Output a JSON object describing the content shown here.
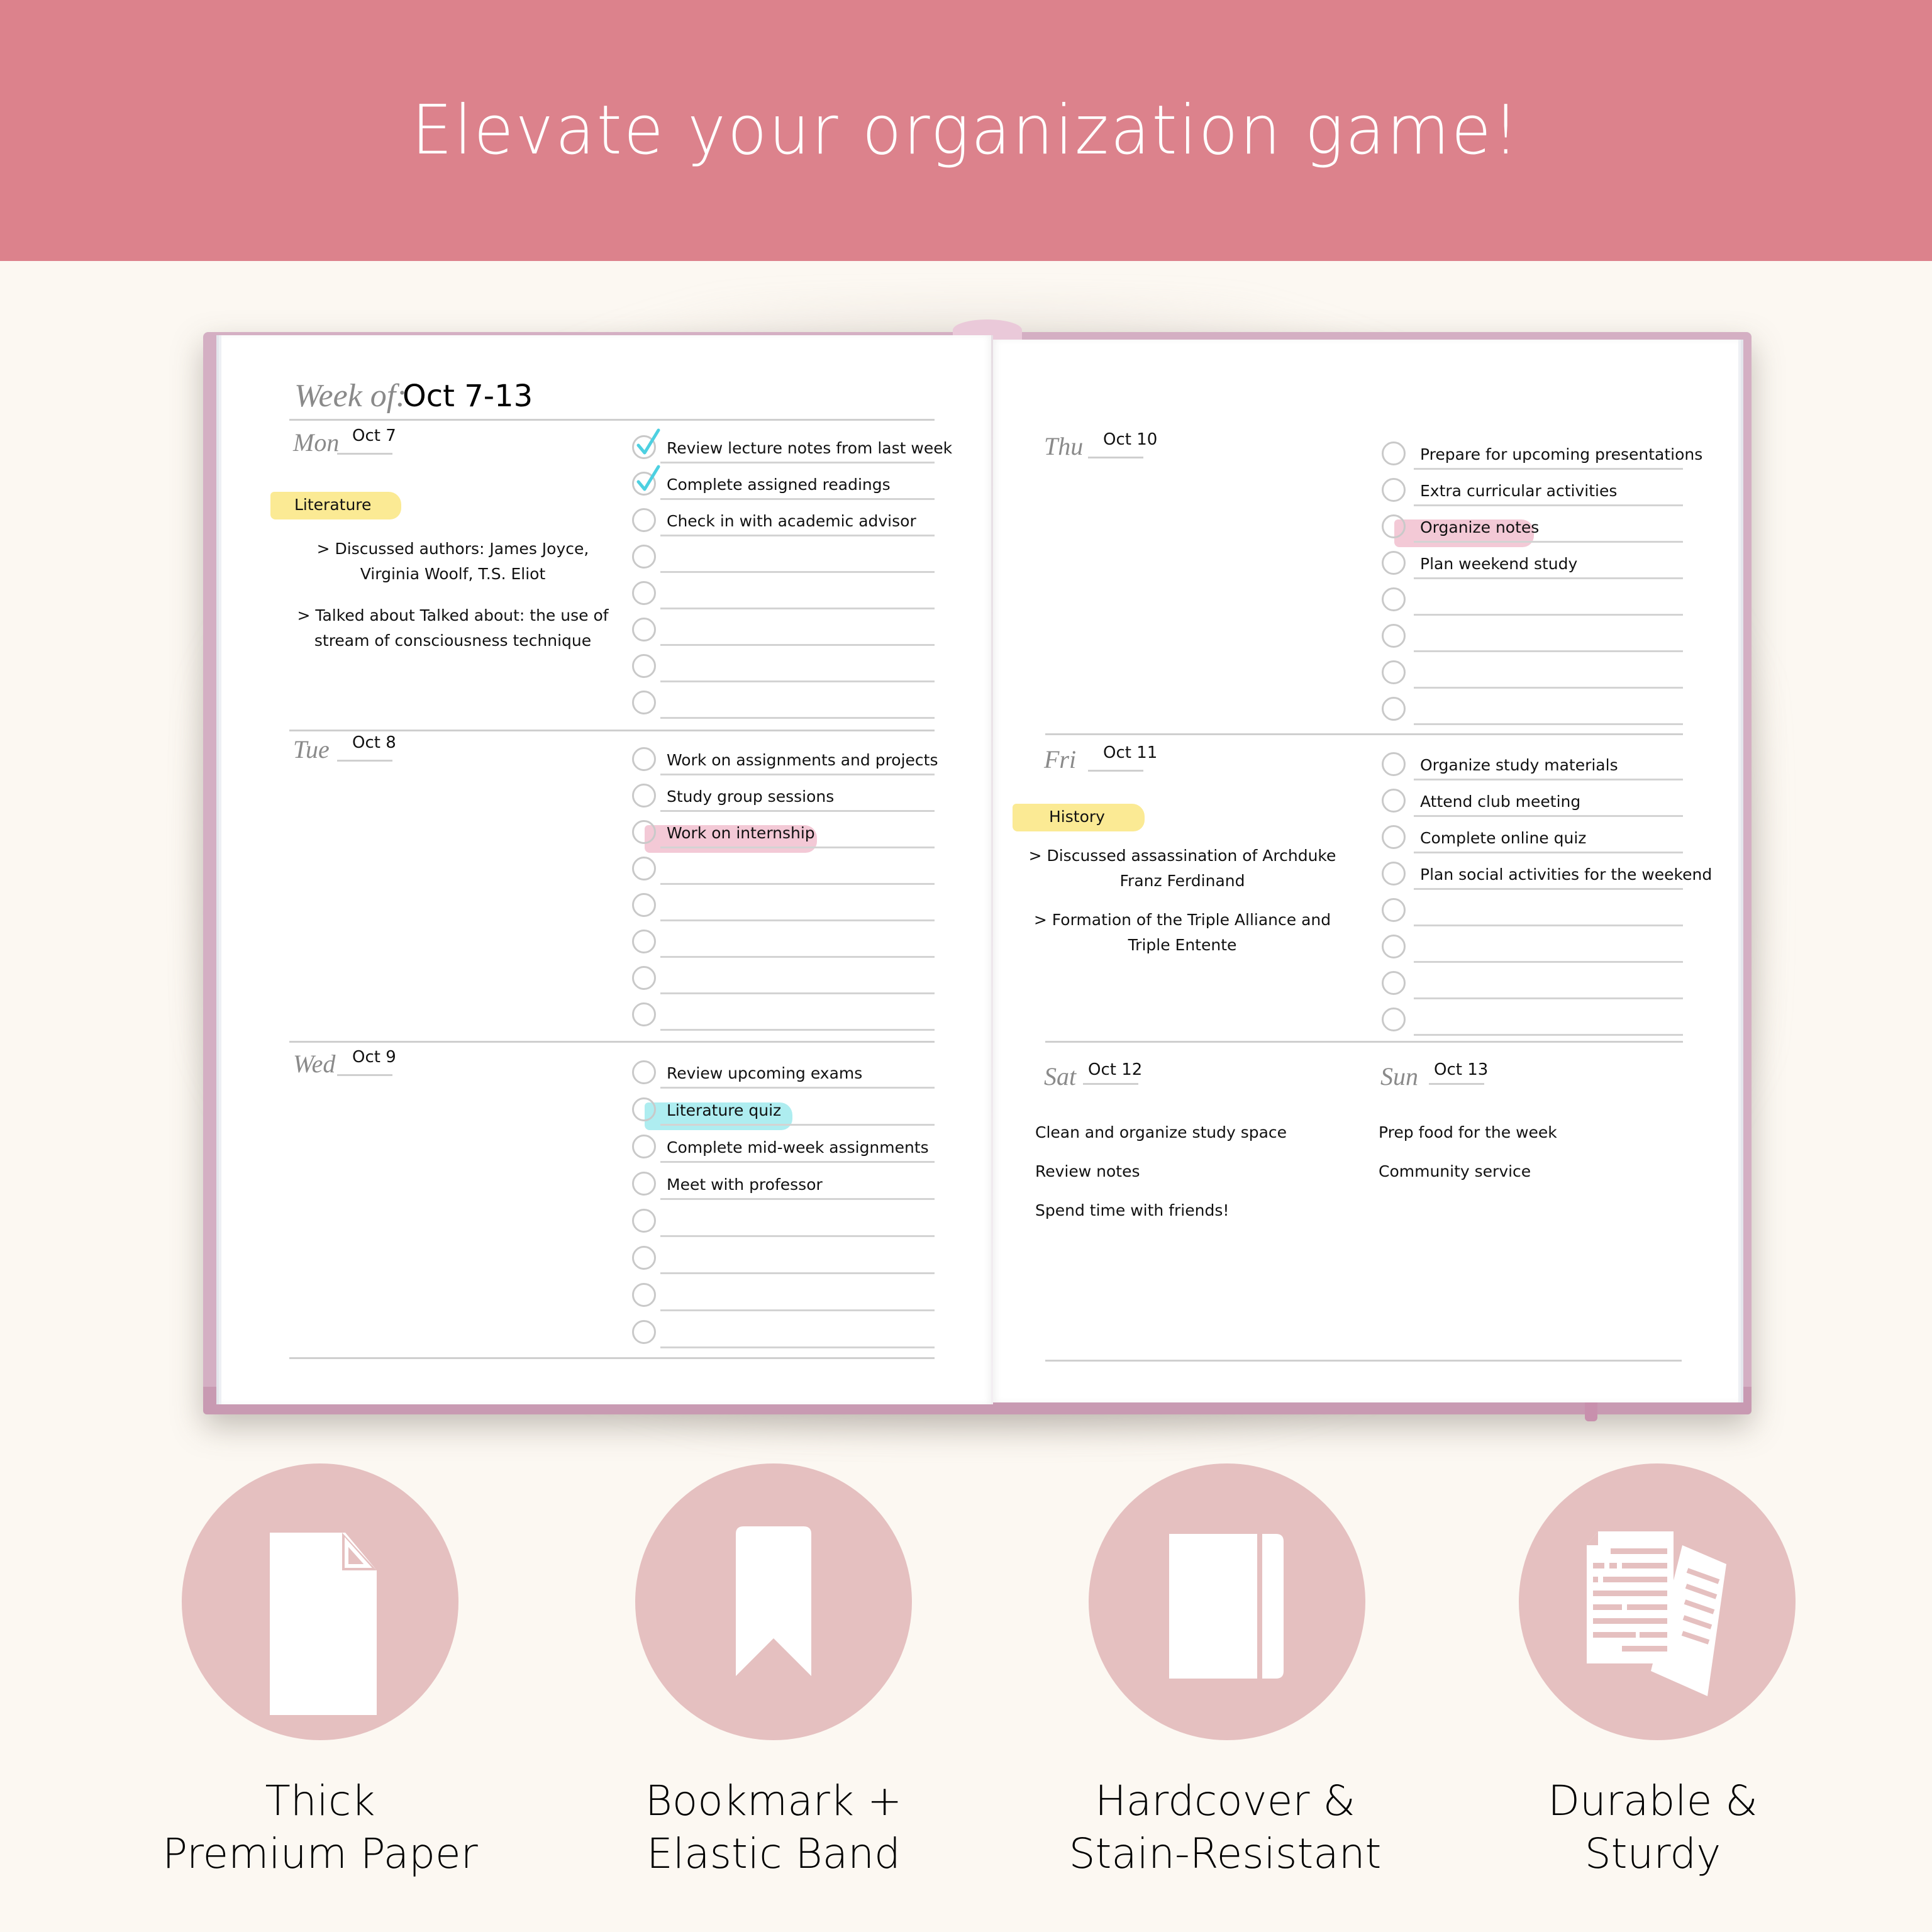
{
  "header": {
    "title": "Elevate your organization game!",
    "background_color": "#DC828C"
  },
  "planner": {
    "week_label": "Week of:",
    "week_value": "Oct 7-13",
    "colors": {
      "checkmark": "#4DD0E1",
      "highlight_yellow": "#FBEA94",
      "highlight_pink": "#F3C9D6",
      "highlight_blue": "#AEEDF0",
      "cover": "#D4AFC3"
    },
    "days": {
      "mon": {
        "label": "Mon",
        "date": "Oct 7",
        "subject": "Literature",
        "notes": [
          "> Discussed authors:  James Joyce,",
          "Virginia Woolf, T.S. Eliot",
          "> Talked about Talked about: the use of",
          "stream of consciousness technique"
        ],
        "tasks": [
          {
            "text": "Review lecture notes from last week",
            "checked": true
          },
          {
            "text": "Complete assigned readings",
            "checked": true
          },
          {
            "text": "Check in with academic advisor",
            "checked": false
          },
          {
            "text": "",
            "checked": false
          },
          {
            "text": "",
            "checked": false
          },
          {
            "text": "",
            "checked": false
          },
          {
            "text": "",
            "checked": false
          },
          {
            "text": "",
            "checked": false
          }
        ]
      },
      "tue": {
        "label": "Tue",
        "date": "Oct 8",
        "tasks": [
          {
            "text": "Work on assignments and projects",
            "checked": false
          },
          {
            "text": "Study group sessions",
            "checked": false
          },
          {
            "text": "Work on internship",
            "checked": false,
            "highlight": "pink"
          },
          {
            "text": "",
            "checked": false
          },
          {
            "text": "",
            "checked": false
          },
          {
            "text": "",
            "checked": false
          },
          {
            "text": "",
            "checked": false
          },
          {
            "text": "",
            "checked": false
          }
        ]
      },
      "wed": {
        "label": "Wed",
        "date": "Oct 9",
        "tasks": [
          {
            "text": "Review upcoming exams",
            "checked": false
          },
          {
            "text": "Literature quiz",
            "checked": false,
            "highlight": "blue"
          },
          {
            "text": "Complete mid-week assignments",
            "checked": false
          },
          {
            "text": "Meet with professor",
            "checked": false
          },
          {
            "text": "",
            "checked": false
          },
          {
            "text": "",
            "checked": false
          },
          {
            "text": "",
            "checked": false
          },
          {
            "text": "",
            "checked": false
          }
        ]
      },
      "thu": {
        "label": "Thu",
        "date": "Oct 10",
        "tasks": [
          {
            "text": "Prepare for upcoming presentations",
            "checked": false
          },
          {
            "text": "Extra curricular activities",
            "checked": false
          },
          {
            "text": "Organize notes",
            "checked": false,
            "highlight": "pink"
          },
          {
            "text": "Plan weekend study",
            "checked": false
          },
          {
            "text": "",
            "checked": false
          },
          {
            "text": "",
            "checked": false
          },
          {
            "text": "",
            "checked": false
          },
          {
            "text": "",
            "checked": false
          }
        ]
      },
      "fri": {
        "label": "Fri",
        "date": "Oct 11",
        "subject": "History",
        "notes": [
          "> Discussed assassination of Archduke",
          "Franz Ferdinand",
          "> Formation of the Triple Alliance and",
          "Triple Entente"
        ],
        "tasks": [
          {
            "text": "Organize study materials",
            "checked": false
          },
          {
            "text": "Attend club meeting",
            "checked": false
          },
          {
            "text": "Complete online quiz",
            "checked": false
          },
          {
            "text": "Plan social activities for the weekend",
            "checked": false
          },
          {
            "text": "",
            "checked": false
          },
          {
            "text": "",
            "checked": false
          },
          {
            "text": "",
            "checked": false
          },
          {
            "text": "",
            "checked": false
          }
        ]
      },
      "sat": {
        "label": "Sat",
        "date": "Oct 12",
        "items": [
          "Clean and organize study space",
          "Review notes",
          "Spend time with friends!"
        ]
      },
      "sun": {
        "label": "Sun",
        "date": "Oct 13",
        "items": [
          "Prep food for the week",
          "Community service"
        ]
      }
    }
  },
  "features": [
    {
      "icon": "document-icon",
      "line1": "Thick",
      "line2": "Premium Paper"
    },
    {
      "icon": "bookmark-icon",
      "line1": "Bookmark +",
      "line2": "Elastic Band"
    },
    {
      "icon": "notebook-icon",
      "line1": "Hardcover &",
      "line2": "Stain-Resistant"
    },
    {
      "icon": "stacked-papers-icon",
      "line1": "Durable &",
      "line2": "Sturdy"
    }
  ],
  "feature_circle_color": "#E5C0C0"
}
